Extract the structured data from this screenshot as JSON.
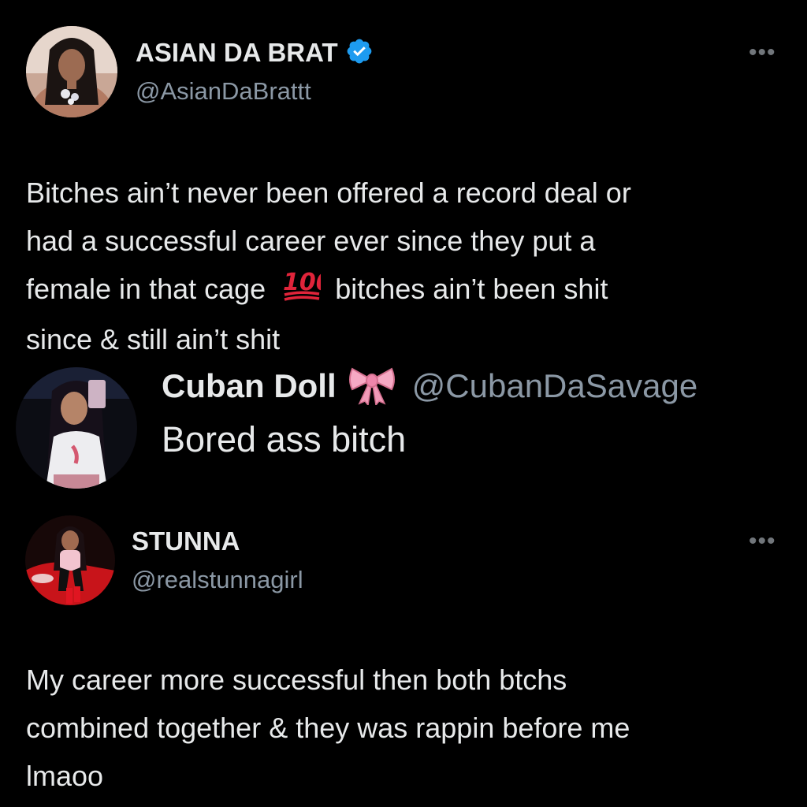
{
  "tweet1": {
    "display_name": "ASIAN DA BRAT",
    "handle": "@AsianDaBrattt",
    "verified_icon": "verified-badge-icon",
    "more_icon": "more-options-icon",
    "more_glyph": "•••",
    "lines": [
      "Bitches ain’t never been offered a record deal or",
      "had a successful career ever since they put a",
      "female in that cage",
      "bitches ain’t been shit",
      "since & still ain’t shit"
    ],
    "emoji_icon": "hundred-points-emoji-icon"
  },
  "quoted": {
    "display_name": "Cuban Doll",
    "emoji_icon": "pink-bow-emoji-icon",
    "handle": "@CubanDaSavage",
    "text": "Bored ass bitch"
  },
  "tweet2": {
    "display_name": "STUNNA",
    "handle": "@realstunnagirl",
    "more_icon": "more-options-icon",
    "more_glyph": "•••",
    "lines": [
      "My career more successful then both btchs",
      "combined together & they was rappin before me",
      "lmaoo"
    ]
  },
  "colors": {
    "background": "#000000",
    "primary_text": "#e7e9ea",
    "secondary_text": "#8b98a5",
    "verified_blue": "#1d9bf0"
  }
}
